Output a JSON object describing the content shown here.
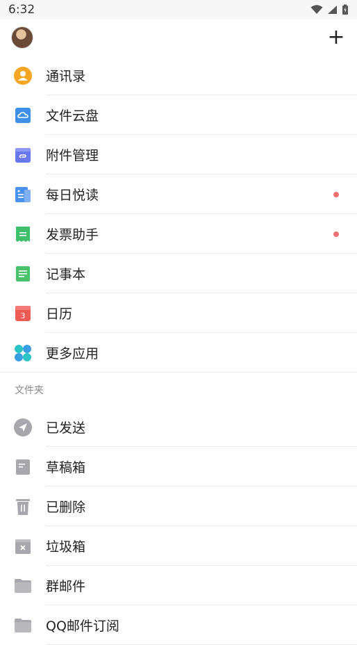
{
  "status_bar": {
    "time": "6:32"
  },
  "header": {
    "add_label": "+"
  },
  "apps": [
    {
      "label": "通讯录",
      "icon": "contacts-icon",
      "color": "#f6a623",
      "dot": false
    },
    {
      "label": "文件云盘",
      "icon": "cloud-drive-icon",
      "color": "#3d8fe8",
      "dot": false
    },
    {
      "label": "附件管理",
      "icon": "attachment-icon",
      "color": "#6a78f0",
      "dot": false
    },
    {
      "label": "每日悦读",
      "icon": "reading-icon",
      "color": "#4b91f1",
      "dot": true
    },
    {
      "label": "发票助手",
      "icon": "invoice-icon",
      "color": "#3fbf6b",
      "dot": true
    },
    {
      "label": "记事本",
      "icon": "notepad-icon",
      "color": "#49c26b",
      "dot": false
    },
    {
      "label": "日历",
      "icon": "calendar-icon",
      "color": "#f05a55",
      "dot": false,
      "badge": "3"
    },
    {
      "label": "更多应用",
      "icon": "more-apps-icon",
      "color": "#2cc5c5",
      "dot": false
    }
  ],
  "folders_title": "文件夹",
  "folders": [
    {
      "label": "已发送",
      "icon": "sent-icon"
    },
    {
      "label": "草稿箱",
      "icon": "drafts-icon"
    },
    {
      "label": "已删除",
      "icon": "trash-icon"
    },
    {
      "label": "垃圾箱",
      "icon": "spam-icon"
    },
    {
      "label": "群邮件",
      "icon": "folder-icon"
    },
    {
      "label": "QQ邮件订阅",
      "icon": "folder-icon"
    }
  ],
  "colors": {
    "dot": "#f07173",
    "folder_gray": "#a7a7ad"
  }
}
